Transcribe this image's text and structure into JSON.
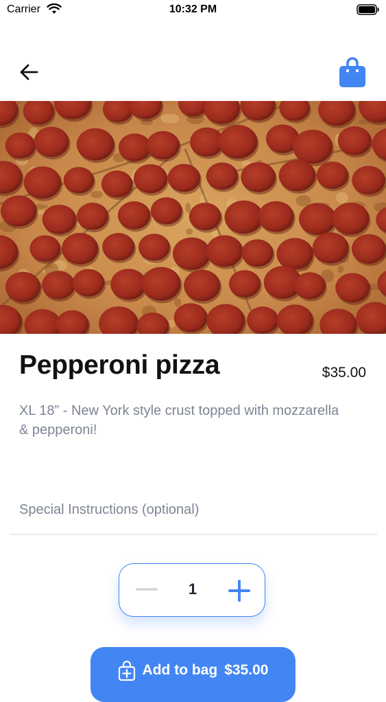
{
  "status_bar": {
    "carrier": "Carrier",
    "time": "10:32 PM"
  },
  "product": {
    "name": "Pepperoni pizza",
    "price": "$35.00",
    "description": "XL 18” - New York style crust topped with mozzarella & pepperoni!"
  },
  "special_instructions": {
    "placeholder": "Special Instructions (optional)"
  },
  "quantity": {
    "value": "1"
  },
  "add_to_bag": {
    "label": "Add to bag",
    "price": "$35.00"
  },
  "colors": {
    "accent": "#4286f4",
    "muted_text": "#7d8494"
  },
  "icons": {
    "back": "arrow-left-icon",
    "bag": "shopping-bag-icon",
    "minus": "minus-icon",
    "plus": "plus-icon",
    "add_to_bag": "bag-plus-icon"
  }
}
